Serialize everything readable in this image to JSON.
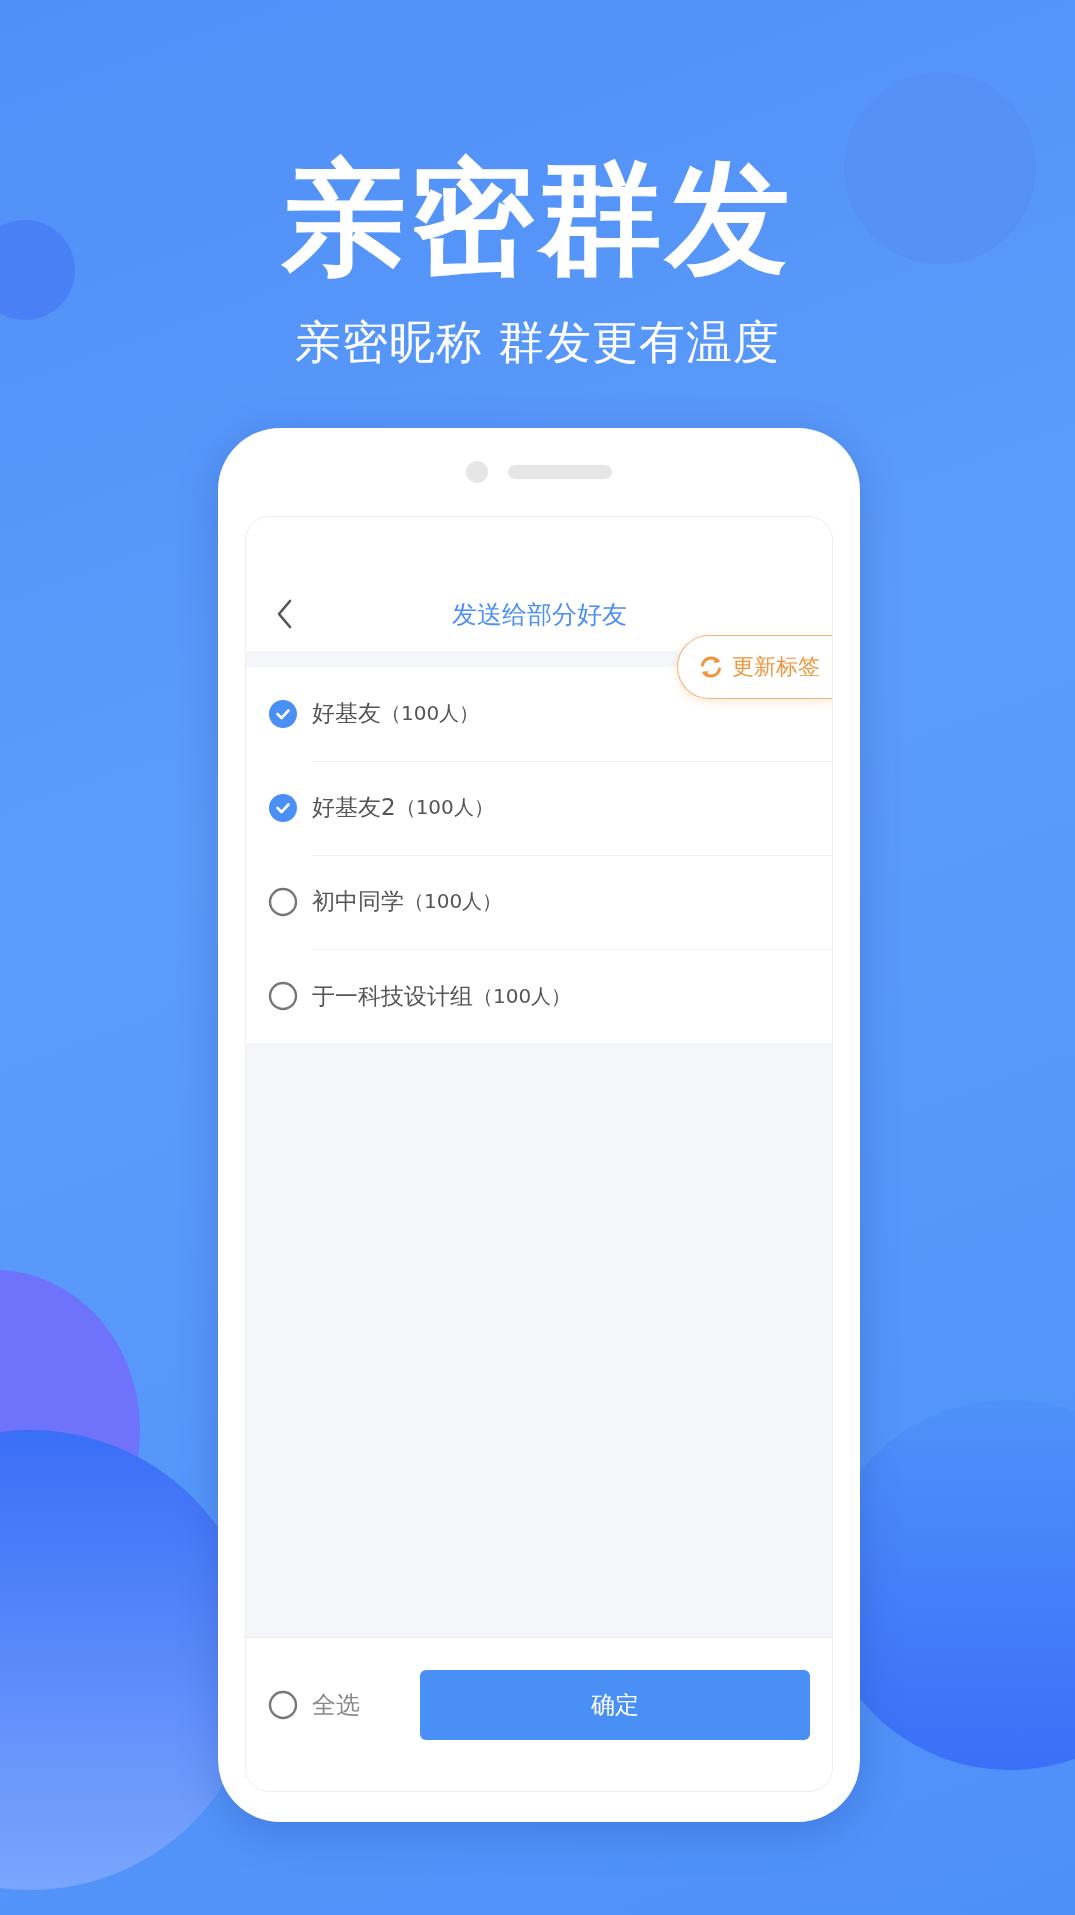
{
  "headline": "亲密群发",
  "subtitle": "亲密昵称 群发更有温度",
  "screen": {
    "title": "发送给部分好友",
    "update_tag_button": "更新标签",
    "groups": [
      {
        "name": "好基友",
        "count": "（100人）",
        "checked": true
      },
      {
        "name": "好基友2",
        "count": "（100人）",
        "checked": true
      },
      {
        "name": "初中同学",
        "count": "（100人）",
        "checked": false
      },
      {
        "name": "于一科技设计组",
        "count": "（100人）",
        "checked": false
      }
    ],
    "select_all": {
      "label": "全选",
      "checked": false
    },
    "confirm_button": "确定"
  }
}
